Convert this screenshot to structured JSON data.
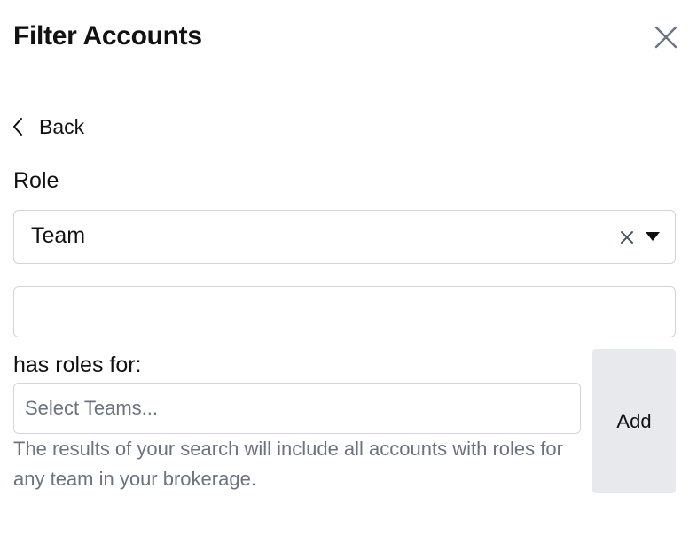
{
  "header": {
    "title": "Filter Accounts",
    "close_icon": "close-icon"
  },
  "nav": {
    "back_label": "Back",
    "back_icon": "chevron-left-icon"
  },
  "role": {
    "label": "Role",
    "selected_value": "Team",
    "clear_icon": "clear-icon",
    "dropdown_icon": "caret-down-icon"
  },
  "extra_field": {
    "value": ""
  },
  "teams": {
    "label": "has roles for:",
    "placeholder": "Select Teams...",
    "value": "",
    "add_label": "Add",
    "help_text": "The results of your search will include all accounts with roles for any team in your brokerage."
  },
  "colors": {
    "border": "#d1d5db",
    "muted_text": "#6b7280",
    "button_bg": "#e8e9ed",
    "text": "#111111"
  }
}
